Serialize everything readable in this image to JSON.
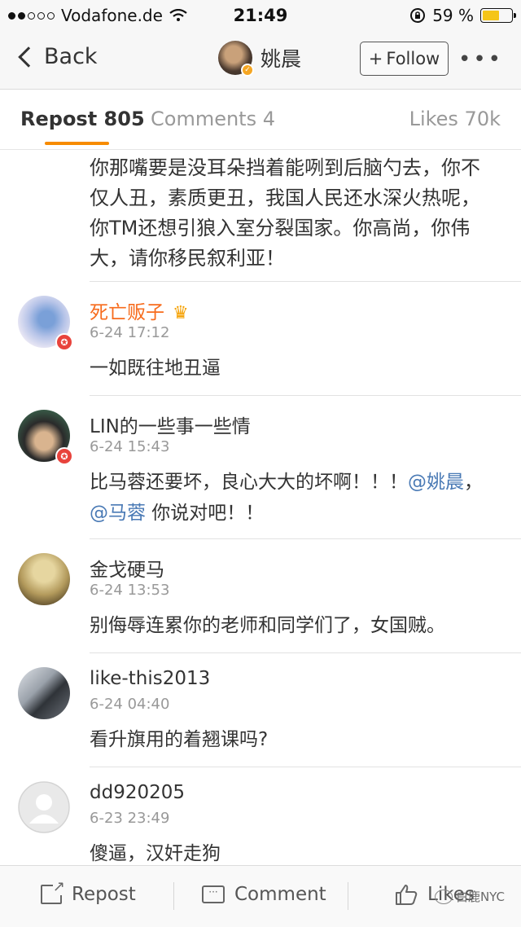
{
  "status_bar": {
    "carrier": "Vodafone.de",
    "time": "21:49",
    "battery": "59 %",
    "battery_level": 0.59,
    "icons": [
      "signal-dots-icon",
      "wifi-icon",
      "rotation-lock-icon",
      "battery-icon"
    ]
  },
  "nav": {
    "back_label": "Back",
    "title": "姚晨",
    "follow_label": "Follow",
    "follow_plus": "+",
    "more_label": "•••"
  },
  "tabs": {
    "repost": "Repost 805",
    "comments": "Comments 4",
    "likes": "Likes 70k"
  },
  "first_comment_text": "你那嘴要是没耳朵挡着能咧到后脑勺去，你不仅人丑，素质更丑，我国人民还水深火热呢，你TM还想引狼入室分裂国家。你高尚，你伟大，请你移民叙利亚！",
  "comments": [
    {
      "name": "死亡贩子",
      "time": "6-24 17:12",
      "text": "一如既往地丑逼",
      "crown": "♛"
    },
    {
      "name": "LIN的一些事一些情",
      "time": "6-24 15:43",
      "text_before": "比马蓉还要坏，良心大大的坏啊！！！",
      "mention1": "@姚晨",
      "text_mid": "，",
      "mention2": "@马蓉",
      "text_after": " 你说对吧！！"
    },
    {
      "name": "金戈硬马",
      "time": "6-24 13:53",
      "text": "别侮辱连累你的老师和同学们了，女国贼。"
    },
    {
      "name": "like-this2013",
      "time": "6-24 04:40",
      "text": "看升旗用的着翘课吗?"
    },
    {
      "name": "dd920205",
      "time": "6-23 23:49",
      "text": "傻逼，汉奸走狗"
    }
  ],
  "bottom_bar": {
    "repost": "Repost",
    "comment": "Comment",
    "likes": "Likes"
  },
  "watermark": "白鹿NYC",
  "colors": {
    "accent": "#f78b00",
    "mention": "#4a7ab5",
    "vip_name": "#f76b1c",
    "badge_red": "#e8433c"
  }
}
